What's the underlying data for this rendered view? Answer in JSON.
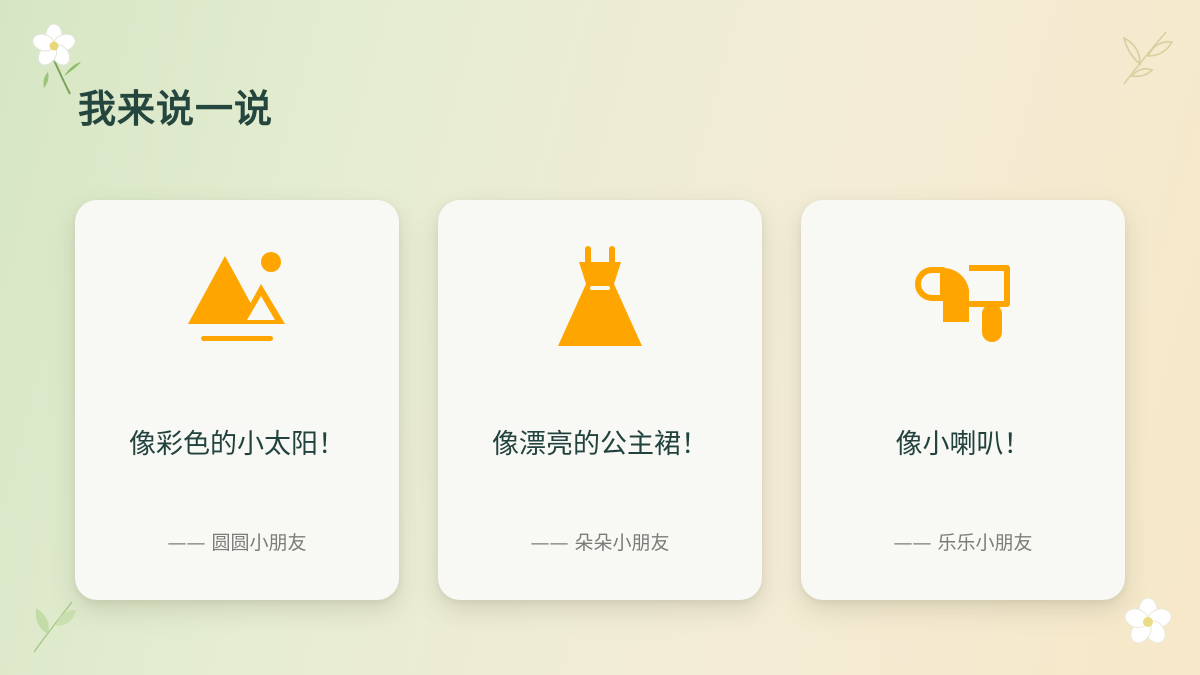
{
  "slide": {
    "title": "我来说一说"
  },
  "theme": {
    "accent": "#FFA500",
    "title_color": "#24463F",
    "card_background": "#F8F8F5",
    "author_color": "#7B7B78"
  },
  "cards": [
    {
      "icon": "mountain-image-icon",
      "quote": "像彩色的小太阳！",
      "author": "—— 圆圆小朋友"
    },
    {
      "icon": "dress-icon",
      "quote": "像漂亮的公主裙！",
      "author": "—— 朵朵小朋友"
    },
    {
      "icon": "hair-dryer-icon",
      "quote": "像小喇叭！",
      "author": "—— 乐乐小朋友"
    }
  ],
  "decorations": [
    "white-flower-icon",
    "leaf-outline-icon",
    "leaf-icon",
    "white-flower-icon"
  ]
}
